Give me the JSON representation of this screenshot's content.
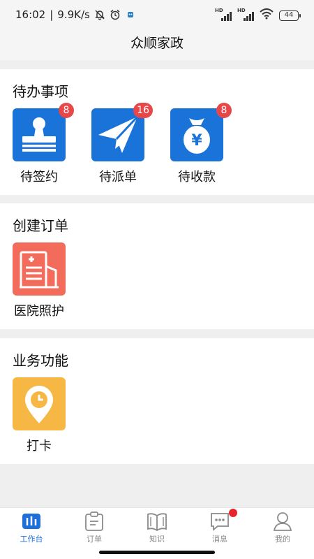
{
  "status_bar": {
    "time": "16:02",
    "speed": "9.9K/s",
    "hd_1": "HD",
    "hd_2": "HD",
    "battery": "44",
    "icons": [
      "mute-bell-icon",
      "alarm-icon",
      "app-notification-icon",
      "signal-icon",
      "signal-icon",
      "wifi-icon",
      "battery-icon"
    ]
  },
  "header": {
    "title": "众顺家政"
  },
  "sections": {
    "todo": {
      "title": "待办事项",
      "items": [
        {
          "label": "待签约",
          "badge": "8",
          "icon": "stamp-icon",
          "color": "#1a73d9"
        },
        {
          "label": "待派单",
          "badge": "16",
          "icon": "paper-plane-icon",
          "color": "#1a73d9"
        },
        {
          "label": "待收款",
          "badge": "8",
          "icon": "money-bag-icon",
          "color": "#1a73d9"
        }
      ]
    },
    "create": {
      "title": "创建订单",
      "items": [
        {
          "label": "医院照护",
          "icon": "hospital-icon",
          "color": "#f26b5b"
        }
      ]
    },
    "business": {
      "title": "业务功能",
      "items": [
        {
          "label": "打卡",
          "icon": "clock-in-pin-icon",
          "color": "#f6b745"
        }
      ]
    }
  },
  "tabbar": {
    "active_color": "#1e6fd9",
    "items": [
      {
        "label": "工作台",
        "icon": "workbench-icon",
        "active": true
      },
      {
        "label": "订单",
        "icon": "order-clipboard-icon",
        "active": false
      },
      {
        "label": "知识",
        "icon": "book-icon",
        "active": false
      },
      {
        "label": "消息",
        "icon": "message-icon",
        "active": false,
        "has_dot": true
      },
      {
        "label": "我的",
        "icon": "profile-icon",
        "active": false
      }
    ]
  }
}
